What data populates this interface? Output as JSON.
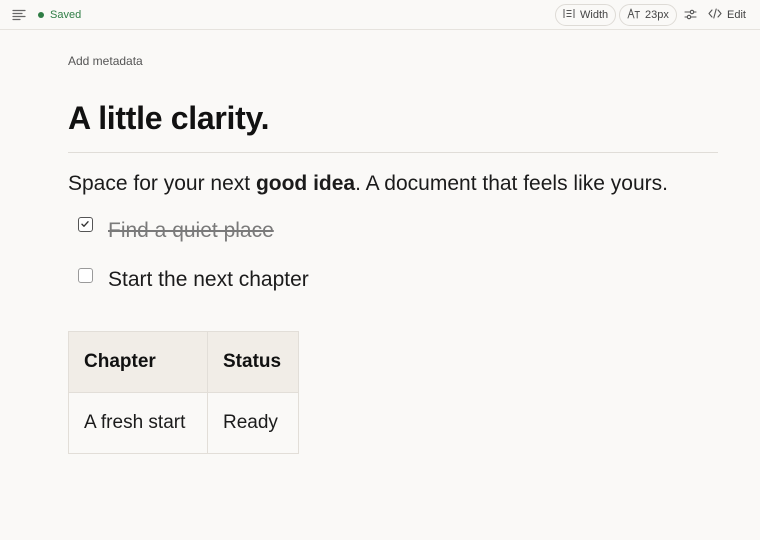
{
  "toolbar": {
    "status": "Saved",
    "status_color": "#2f7d45",
    "width_label": "Width",
    "font_size_label": "23px",
    "edit_label": "Edit",
    "icons": [
      "menu-icon",
      "width-icon",
      "font-size-icon",
      "settings-sliders-icon",
      "code-icon"
    ]
  },
  "document": {
    "add_metadata": "Add metadata",
    "title": "A little clarity.",
    "paragraph": {
      "before": "Space for your next ",
      "bold": "good idea",
      "after": ". A document that feels like yours."
    },
    "tasks": [
      {
        "label": "Find a quiet place",
        "checked": true
      },
      {
        "label": "Start the next chapter",
        "checked": false
      }
    ],
    "table": {
      "headers": [
        "Chapter",
        "Status"
      ],
      "rows": [
        [
          "A fresh start",
          "Ready"
        ]
      ]
    }
  }
}
